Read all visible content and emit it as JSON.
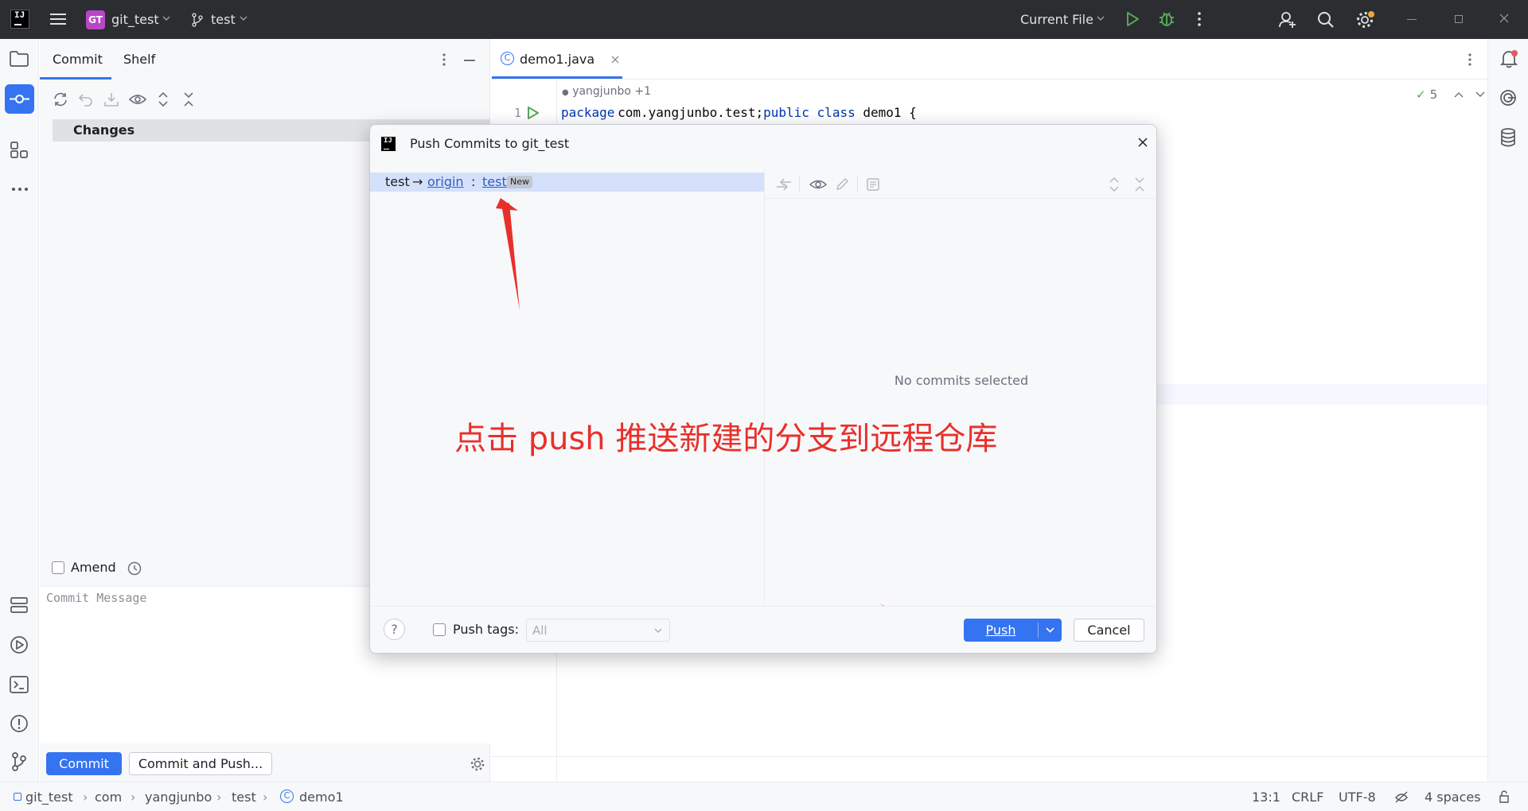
{
  "titlebar": {
    "app_logo": "IJ",
    "menu_icon": "hamburger-menu-icon",
    "project_badge": "GT",
    "project_name": "git_test",
    "branch_name": "test",
    "run_config": "Current File",
    "colors": {
      "background": "#2b2d30",
      "project_badge": "#b847c6",
      "run": "#57a55a"
    }
  },
  "left_strip": {
    "items": [
      "project-icon",
      "commit-icon",
      "structure-icon",
      "more-icon",
      "services-icon",
      "run-icon",
      "terminal-icon",
      "problems-icon",
      "git-icon"
    ]
  },
  "commit_panel": {
    "tabs": [
      {
        "label": "Commit",
        "active": true
      },
      {
        "label": "Shelf",
        "active": false
      }
    ],
    "changes_label": "Changes",
    "amend_label": "Amend",
    "commit_message_placeholder": "Commit Message",
    "commit_button": "Commit",
    "commit_and_push_button": "Commit and Push..."
  },
  "editor": {
    "tab_label": "demo1.java",
    "author_hint": "yangjunbo +1",
    "line_number": "1",
    "code": {
      "kw_package": "package",
      "pkg": "com.yangjunbo.test;",
      "kw_public": "public",
      "kw_class": "class",
      "cls": "demo1 {"
    },
    "inspection_count": "5"
  },
  "dialog": {
    "title": "Push Commits to git_test",
    "branch_row": {
      "local": "test",
      "arrow": "→",
      "remote": "origin",
      "separator": ":",
      "remote_branch": "test",
      "badge": "New"
    },
    "empty_details": "No commits selected",
    "annotation": "点击 push 推送新建的分支到远程仓库",
    "push_tags_label": "Push tags:",
    "tags_select_value": "All",
    "push_button": "Push",
    "cancel_button": "Cancel",
    "help": "?"
  },
  "statusbar": {
    "breadcrumbs": [
      "git_test",
      "com",
      "yangjunbo",
      "test",
      "demo1"
    ],
    "position": "13:1",
    "line_sep": "CRLF",
    "encoding": "UTF-8",
    "indent": "4 spaces"
  },
  "colors": {
    "accent": "#3574f0",
    "annotation_red": "#e8302b",
    "link": "#2f5fc1",
    "selection": "#d5e1fb"
  }
}
